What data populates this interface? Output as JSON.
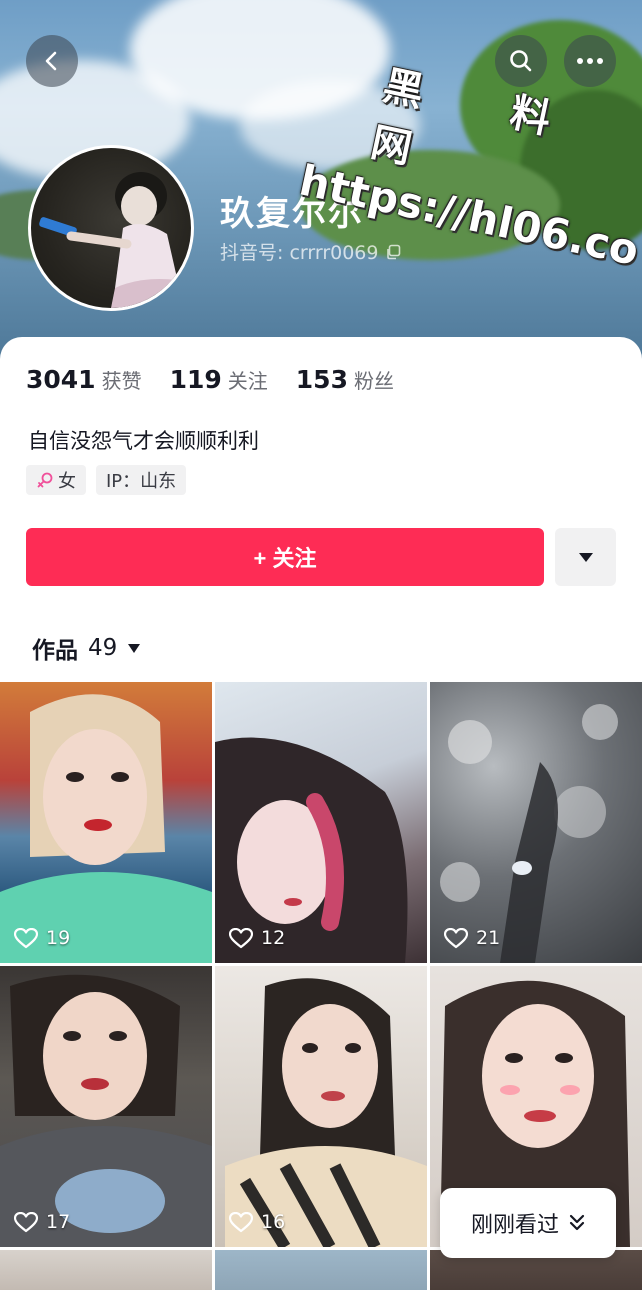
{
  "header": {
    "back_icon": "back-arrow-icon",
    "search_icon": "search-icon",
    "more_icon": "more-dots-icon",
    "nickname": "玖复尔尔",
    "douyin_id": "抖音号: crrrr0069",
    "copy_icon": "copy-icon"
  },
  "watermark": {
    "line1": "黑 料 网",
    "line2": "https://hl06.co"
  },
  "stats": [
    {
      "number": "3041",
      "label": "获赞"
    },
    {
      "number": "119",
      "label": "关注"
    },
    {
      "number": "153",
      "label": "粉丝"
    }
  ],
  "bio": "自信没怨气才会顺顺利利",
  "tags": {
    "gender": "女",
    "ip": "IP：山东"
  },
  "actions": {
    "follow_label": "+ 关注",
    "more_icon": "triangle-down-icon"
  },
  "works_tab": {
    "label": "作品",
    "count": "49"
  },
  "videos": [
    {
      "likes": "19"
    },
    {
      "likes": "12"
    },
    {
      "likes": "21"
    },
    {
      "likes": "17"
    },
    {
      "likes": "16"
    },
    {
      "likes": ""
    }
  ],
  "recent_button": {
    "label": "刚刚看过"
  },
  "colors": {
    "accent": "#fe2c55",
    "text": "#161823",
    "muted": "#6b6d74"
  }
}
